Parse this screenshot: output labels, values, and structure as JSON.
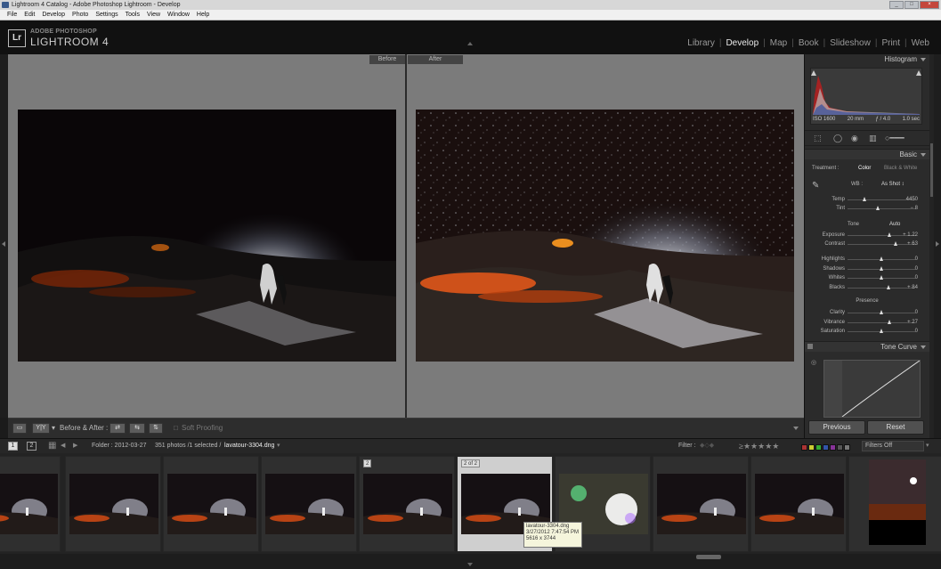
{
  "window": {
    "title": "Lightroom 4 Catalog - Adobe Photoshop Lightroom - Develop",
    "menu": [
      "File",
      "Edit",
      "Develop",
      "Photo",
      "Settings",
      "Tools",
      "View",
      "Window",
      "Help"
    ]
  },
  "logo": {
    "badge": "Lr",
    "top": "ADOBE PHOTOSHOP",
    "main": "LIGHTROOM 4"
  },
  "modules": [
    {
      "label": "Library",
      "active": false
    },
    {
      "label": "Develop",
      "active": true
    },
    {
      "label": "Map",
      "active": false
    },
    {
      "label": "Book",
      "active": false
    },
    {
      "label": "Slideshow",
      "active": false
    },
    {
      "label": "Print",
      "active": false
    },
    {
      "label": "Web",
      "active": false
    }
  ],
  "view": {
    "before_label": "Before",
    "after_label": "After"
  },
  "toolbar": {
    "yy_label": "Y|Y",
    "before_after_label": "Before & After :",
    "soft_proofing_label": "Soft Proofing"
  },
  "histogram": {
    "title": "Histogram",
    "iso": "ISO 1600",
    "focal": "20 mm",
    "aperture": "ƒ / 4.0",
    "shutter": "1.0 sec"
  },
  "basic": {
    "title": "Basic",
    "treatment_label": "Treatment :",
    "color_label": "Color",
    "bw_label": "Black & White",
    "wb_label": "WB :",
    "wb_value": "As Shot ↕",
    "tone_label": "Tone",
    "auto_label": "Auto",
    "presence_label": "Presence",
    "sliders": [
      {
        "label": "Temp",
        "value": "4450",
        "pos": 0.25
      },
      {
        "label": "Tint",
        "value": "− 8",
        "pos": 0.45
      },
      {
        "label": "Exposure",
        "value": "+ 1.22",
        "pos": 0.62
      },
      {
        "label": "Contrast",
        "value": "+ 63",
        "pos": 0.71
      },
      {
        "label": "Highlights",
        "value": "0",
        "pos": 0.5
      },
      {
        "label": "Shadows",
        "value": "0",
        "pos": 0.5
      },
      {
        "label": "Whites",
        "value": "0",
        "pos": 0.5
      },
      {
        "label": "Blacks",
        "value": "+ 84",
        "pos": 0.6
      },
      {
        "label": "Clarity",
        "value": "0",
        "pos": 0.5
      },
      {
        "label": "Vibrance",
        "value": "+ 27",
        "pos": 0.62
      },
      {
        "label": "Saturation",
        "value": "0",
        "pos": 0.5
      }
    ]
  },
  "tone_curve": {
    "title": "Tone Curve"
  },
  "buttons": {
    "previous": "Previous",
    "reset": "Reset"
  },
  "filmstrip_bar": {
    "page1": "1",
    "page2": "2",
    "folder": "Folder : 2012-03-27",
    "count": "351 photos /1 selected /",
    "filename": "lavatour-3304.dng",
    "filter_label": "Filter :",
    "filters_off": "Filters Off"
  },
  "filmstrip": {
    "badges": [
      "2",
      "2 of 2"
    ],
    "tooltip": {
      "name": "lavatour-3304.dng",
      "date": "3/27/2012 7:47:54 PM",
      "dims": "5616 x 3744"
    }
  },
  "colors": {
    "accent": "#ffffff",
    "panel": "#2b2b2b",
    "canvas": "#7b7b7b"
  }
}
